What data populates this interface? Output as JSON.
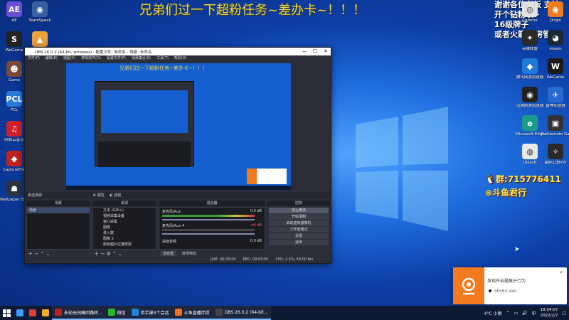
{
  "overlay": {
    "banner": "兄弟们过一下超粉任务~差办卡~！！！",
    "right_note_lines": [
      "谢谢各位老板 支持",
      "开个钻粉呗~",
      "16级牌子",
      "或者火箭*2房管"
    ],
    "qq_text": "群:715776411",
    "douyu_text": "斗鱼君行"
  },
  "desktop": {
    "left_icons": [
      {
        "label": "AE",
        "color": "#6a4ed6",
        "glyph": "AE"
      },
      {
        "label": "TeamSpeak",
        "color": "#3a5fa0",
        "glyph": "◉"
      },
      {
        "label": "WeGame",
        "color": "#222",
        "glyph": "S"
      },
      {
        "label": "Toolbox",
        "color": "#e9a23b",
        "glyph": "▲"
      },
      {
        "label": "Game",
        "color": "#7a4a3a",
        "glyph": "☻"
      },
      {
        "label": "搜狐影音播放器",
        "color": "#111",
        "glyph": "▼"
      },
      {
        "label": "PCL",
        "color": "#2a7ad6",
        "glyph": "PCL"
      },
      {
        "label": "MAXON",
        "color": "#ffffff",
        "glyph": "M"
      },
      {
        "label": "网易云音乐",
        "color": "#d0202a",
        "glyph": "♫"
      },
      {
        "label": "优化大师",
        "color": "#111",
        "glyph": "☻"
      },
      {
        "label": "CaptureFire",
        "color": "#c0231f",
        "glyph": "◆"
      },
      {
        "label": "Apex Legends",
        "color": "#c43a2a",
        "glyph": "A"
      },
      {
        "label": "Wallpaper Engine",
        "color": "#2a3440",
        "glyph": "☗"
      }
    ],
    "right_icons": [
      {
        "label": "Chrome",
        "color": "#e0e0e0",
        "glyph": "◎"
      },
      {
        "label": "Origin",
        "color": "#f07a20",
        "glyph": "◉"
      },
      {
        "label": "英雄联盟",
        "color": "#2a2a2a",
        "glyph": "✦"
      },
      {
        "label": "steam",
        "color": "#1b2838",
        "glyph": "◕"
      },
      {
        "label": "腾讯网游加速器",
        "color": "#1e7ad6",
        "glyph": "◆"
      },
      {
        "label": "WeGame",
        "color": "#1a1a1a",
        "glyph": "W"
      },
      {
        "label": "迅游网游加速器",
        "color": "#222",
        "glyph": "◉"
      },
      {
        "label": "雷神加速器",
        "color": "#2a6ad0",
        "glyph": "✈"
      },
      {
        "label": "Microsoft Edge",
        "color": "#1a9a8a",
        "glyph": "e"
      },
      {
        "label": "Battlestate Games L...",
        "color": "#333",
        "glyph": "▣"
      },
      {
        "label": "Ubisoft",
        "color": "#e8e8e8",
        "glyph": "◍"
      },
      {
        "label": "最终幻想XIV",
        "color": "#2a2a2a",
        "glyph": "✧"
      }
    ]
  },
  "obs": {
    "title": "OBS 26.0.2 (64-bit, windows) - 配置文件: 未命名 - 场景: 未命名",
    "menu": [
      "文件(F)",
      "编辑(E)",
      "视图(V)",
      "停靠部件(D)",
      "配置文件(P)",
      "场景集合(S)",
      "工具(T)",
      "帮助(H)"
    ],
    "no_source": "未选择源",
    "props_btn": "属性",
    "filter_btn": "滤镜",
    "panels": {
      "scenes": "场景",
      "sources": "来源",
      "mixer": "混音器",
      "transitions": "转场特效",
      "controls": "控制"
    },
    "scene_list": [
      "场景"
    ],
    "sources": [
      "文本 (GDI+)",
      "视频采集设备",
      "窗口采集",
      "图像",
      "录入数",
      "图像 2",
      "颜色图片位置修改"
    ],
    "mixer_tracks": [
      {
        "name": "麦克风/Aux",
        "db": "0.0 dB"
      },
      {
        "name": "麦克风/Aux 4",
        "db": "-inf dB"
      },
      {
        "name": "桌面音频",
        "db": "0.0 dB"
      }
    ],
    "controls": [
      "停止推流",
      "开始录制",
      "启动虚拟摄像机",
      "工作室模式",
      "设置",
      "退出"
    ],
    "transition_tabs": [
      "混音器",
      "转场特效"
    ],
    "status": [
      "LIVE: 00:00:00",
      "REC: 00:00:00",
      "CPU: 2.5%, 60.00 fps"
    ]
  },
  "notification": {
    "message": "发现开启摄像头行为",
    "user": "obs64.exe",
    "close": "×"
  },
  "taskbar": {
    "items": [
      {
        "label": "",
        "color": "#3aa0ff"
      },
      {
        "label": "",
        "color": "#e03a3a"
      },
      {
        "label": "",
        "color": "#f0b020"
      },
      {
        "label": "永劫无间峰回路转...",
        "color": "#c02020",
        "open": true
      },
      {
        "label": "微信",
        "color": "#2aba2a",
        "open": true
      },
      {
        "label": "单手操3个会话",
        "color": "#1a88e0",
        "open": true
      },
      {
        "label": "斗鱼直播伴侣",
        "color": "#f07020",
        "open": true
      },
      {
        "label": "OBS 26.0.2 (64-bit...",
        "color": "#444",
        "open": true
      }
    ],
    "weather": "4°C 小雨",
    "lang": "中",
    "time": "18:04:07",
    "date": "2022/2/7"
  }
}
